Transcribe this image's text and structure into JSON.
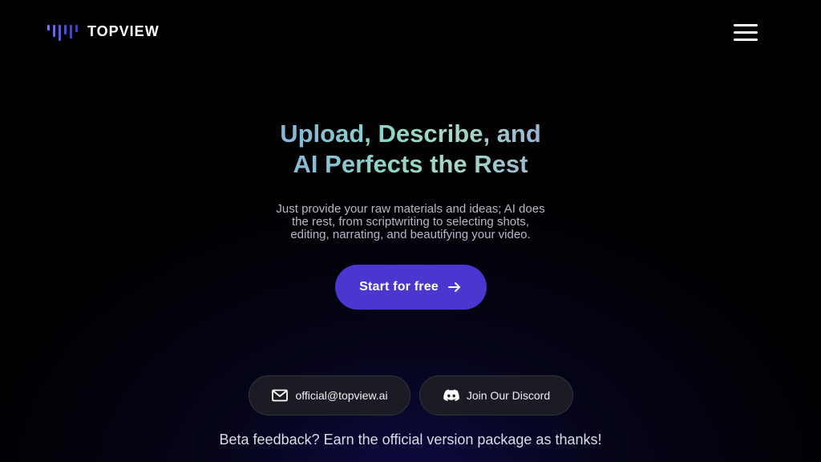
{
  "brand": {
    "name": "TOPVIEW",
    "logo_icon": "topview-bars-logo",
    "logo_colors": [
      "#5b6cff",
      "#3f44e0"
    ]
  },
  "header": {
    "menu_icon": "hamburger-menu-icon"
  },
  "hero": {
    "title_line1": "Upload, Describe, and",
    "title_line2": "AI Perfects the Rest",
    "subtitle": "Just provide your raw materials and ideas; AI does the rest, from scriptwriting to selecting shots, editing, narrating, and beautifying your video.",
    "cta_label": "Start for free",
    "cta_icon": "arrow-right-icon",
    "cta_color": "#4a37d0"
  },
  "contact": {
    "email_label": "official@topview.ai",
    "email_icon": "mail-icon",
    "discord_label": "Join Our Discord",
    "discord_icon": "discord-icon"
  },
  "footer": {
    "beta_text": "Beta feedback? Earn the official version package as thanks!"
  }
}
